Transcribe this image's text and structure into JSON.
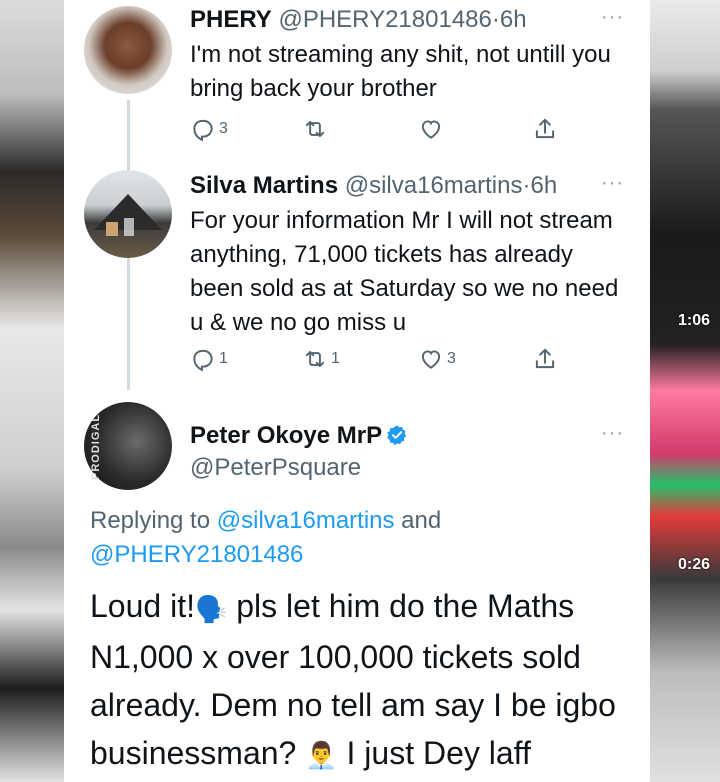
{
  "side_timestamps": [
    "1:06",
    "0:26"
  ],
  "tweets": [
    {
      "name": "PHERY",
      "handle": "@PHERY21801486",
      "time": "6h",
      "text": "I'm not streaming any shit, not untill you bring back your brother",
      "replies": "3",
      "retweets": "",
      "likes": ""
    },
    {
      "name": "Silva Martins",
      "handle": "@silva16martins",
      "time": "6h",
      "text": "For your information Mr I will not stream anything, 71,000 tickets has already been sold as at Saturday so we no need u & we no go miss u",
      "replies": "1",
      "retweets": "1",
      "likes": "3"
    }
  ],
  "main_tweet": {
    "name": "Peter Okoye MrP",
    "handle": "@PeterPsquare",
    "avatar_text": "PRODIGAL",
    "replying_label": "Replying to",
    "reply_mention_1": "@silva16martins",
    "reply_and": "and",
    "reply_mention_2": "@PHERY21801486",
    "text_part1": "Loud it!",
    "emoji1": "🗣️",
    "text_part2": " pls let him do the Maths N1,000 x over 100,000 tickets sold already. Dem no tell am say I be igbo businessman?",
    "emoji2": "👨‍💼",
    "text_part3": " I just Dey laff"
  },
  "colors": {
    "link": "#1d9bf0",
    "muted": "#536471",
    "verified": "#1d9bf0"
  }
}
